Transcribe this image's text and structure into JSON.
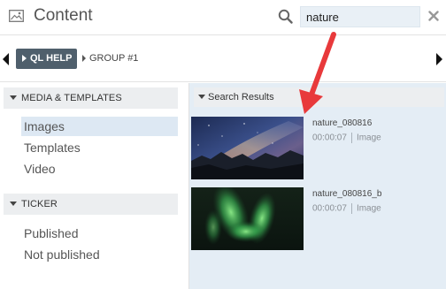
{
  "header": {
    "title": "Content",
    "search_value": "nature",
    "icons": {
      "app": "image-gallery-icon",
      "search": "search-icon",
      "close": "close-icon"
    }
  },
  "groups": {
    "items": [
      {
        "label": "QL HELP",
        "active": true
      },
      {
        "label": "GROUP #1",
        "active": false
      }
    ]
  },
  "sidebar": {
    "sections": [
      {
        "title": "MEDIA & TEMPLATES",
        "items": [
          {
            "label": "Images",
            "selected": true
          },
          {
            "label": "Templates",
            "selected": false
          },
          {
            "label": "Video",
            "selected": false
          }
        ]
      },
      {
        "title": "TICKER",
        "items": [
          {
            "label": "Published",
            "selected": false
          },
          {
            "label": "Not published",
            "selected": false
          }
        ]
      }
    ]
  },
  "results": {
    "title": "Search Results",
    "items": [
      {
        "name": "nature_080816",
        "duration": "00:00:07",
        "type": "Image",
        "thumbnail": "night-sky-milky-way-mountains"
      },
      {
        "name": "nature_080816_b",
        "duration": "00:00:07",
        "type": "Image",
        "thumbnail": "green-aurora"
      }
    ]
  },
  "colors": {
    "accent_chip": "#4f5f6c",
    "selected_bg": "#dde8f3",
    "results_bg": "#e4edf5",
    "search_bg": "#e9f0f6",
    "annotation_arrow": "#e8393b"
  }
}
